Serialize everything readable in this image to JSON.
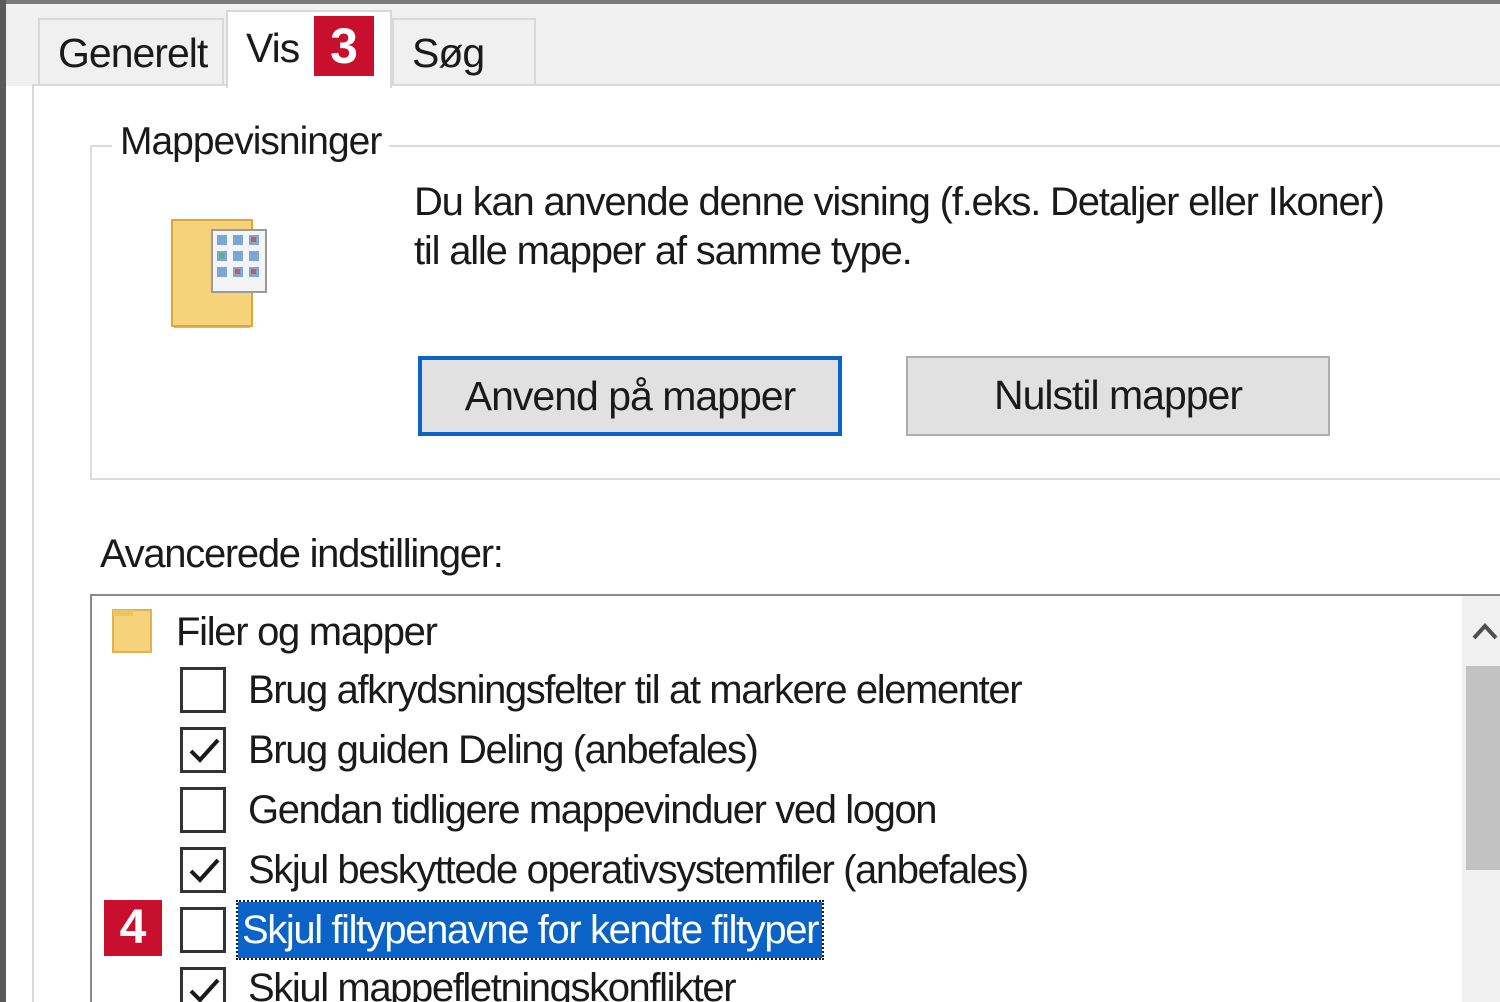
{
  "tabs": [
    {
      "label": "Generelt",
      "active": false
    },
    {
      "label": "Vis",
      "active": true
    },
    {
      "label": "Søg",
      "active": false
    }
  ],
  "badges": {
    "tab_step": "3",
    "row_step": "4"
  },
  "folder_views": {
    "title": "Mappevisninger",
    "description": "Du kan anvende denne visning (f.eks. Detaljer eller Ikoner) til alle mapper af samme type.",
    "apply_button": "Anvend på mapper",
    "reset_button": "Nulstil mapper"
  },
  "advanced": {
    "label": "Avancerede indstillinger:",
    "group_label": "Filer og mapper",
    "items": [
      {
        "label": "Brug afkrydsningsfelter til at markere elementer",
        "checked": false
      },
      {
        "label": "Brug guiden Deling (anbefales)",
        "checked": true
      },
      {
        "label": "Gendan tidligere mappevinduer ved logon",
        "checked": false
      },
      {
        "label": "Skjul beskyttede operativsystemfiler (anbefales)",
        "checked": true
      },
      {
        "label": "Skjul filtypenavne for kendte filtyper",
        "checked": false,
        "selected": true
      },
      {
        "label": "Skjul mappefletningskonflikter",
        "checked": true
      }
    ]
  },
  "colors": {
    "badge": "#c8102e",
    "selection": "#0a64c8",
    "folder": "#f6d37a"
  },
  "icons": {
    "folder_views": "folder-grid-icon",
    "group": "folder-icon",
    "scroll": "chevron-up-icon"
  }
}
